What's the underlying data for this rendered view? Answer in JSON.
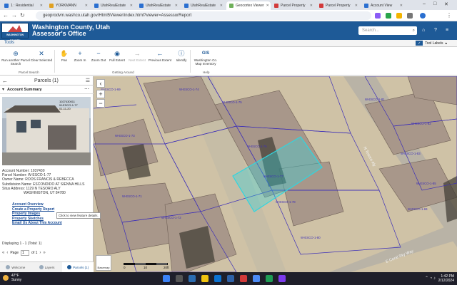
{
  "browser": {
    "tabs": [
      {
        "label": "1 : Residential",
        "color": "#2a6fd0",
        "active": false
      },
      {
        "label": "YORKMANN",
        "color": "#e0a020",
        "active": false
      },
      {
        "label": "UtahRealEstate",
        "color": "#2a6fd0",
        "active": false
      },
      {
        "label": "UtahRealEstate",
        "color": "#2a6fd0",
        "active": false
      },
      {
        "label": "UtahRealEstate",
        "color": "#2a6fd0",
        "active": false
      },
      {
        "label": "Geocortex Viewer",
        "color": "#6fb05a",
        "active": true
      },
      {
        "label": "Parcel Property",
        "color": "#d23a3a",
        "active": false
      },
      {
        "label": "Parcel Property",
        "color": "#d23a3a",
        "active": false
      },
      {
        "label": "Account View",
        "color": "#2a6fd0",
        "active": false
      }
    ],
    "url": "geoprodvm.washco.utah.gov/Html5Viewer/index.html?viewer=AssessorReport"
  },
  "header": {
    "logo_text": "WASHINGTON COUNTY",
    "title_line1": "Washington County, Utah",
    "title_line2": "Assessor's Office",
    "search_placeholder": "Search..."
  },
  "toolbar": {
    "tab_label": "Tools",
    "tool_labels_label": "Tool Labels",
    "tools": [
      {
        "label": "Run another Parcel Search",
        "icon": "binoculars-icon",
        "dim": false
      },
      {
        "label": "Clear Selected",
        "icon": "close-icon",
        "dim": false
      },
      {
        "label": "Pan",
        "icon": "hand-icon",
        "dim": false
      },
      {
        "label": "Zoom In",
        "icon": "plus-icon",
        "dim": false
      },
      {
        "label": "Zoom Out",
        "icon": "minus-icon",
        "dim": false
      },
      {
        "label": "Full Extent",
        "icon": "globe-icon",
        "dim": false
      },
      {
        "label": "Next Extent",
        "icon": "arrow-right-icon",
        "dim": true
      },
      {
        "label": "Previous Extent",
        "icon": "arrow-left-icon",
        "dim": false
      },
      {
        "label": "Identify",
        "icon": "info-icon",
        "dim": false
      },
      {
        "label": "Washington Co. Map Inventory",
        "icon": "gis-icon",
        "dim": false
      }
    ],
    "groups": {
      "search": "Parcel Search",
      "navigation": "Getting Around",
      "help": "Help"
    }
  },
  "panel": {
    "title": "Parcels (1)",
    "section_title": "Account Summary",
    "photo_stamp": [
      "1027430011",
      "W-ESCO-1-77",
      "01-11-20"
    ],
    "info": [
      "Account Number: 1037430",
      "Parcel Number: W-ESCO-1-77",
      "Owner Name: ROOS FRANCIS & REBECCA",
      "Subdivision Name: ESCONDIDO AT SIENNA HILLS",
      "Situs Address: 1129 N TESORO ALY",
      "WASHINGTON, UT 84780"
    ],
    "links": [
      "Account Overview",
      "Create a Property Report",
      "Property Images",
      "Property Sketches",
      "Email Us About This Account"
    ],
    "tooltip": "Click to view feature details.",
    "displaying": "Displaying 1 - 1 (Total: 1)",
    "page_label": "Page",
    "page_value": "1",
    "page_of": "of 1"
  },
  "widgets": [
    {
      "label": "Welcome",
      "active": false
    },
    {
      "label": "Layers",
      "active": false
    },
    {
      "label": "Parcels (1)",
      "active": true
    }
  ],
  "map": {
    "parcel_labels": [
      "W-ESCO-1-77",
      "W-ESCO-1-76",
      "W-ESCO-1-78",
      "W-ESCO-1-75",
      "W-ESCO-1-74",
      "W-ESCO-1-73",
      "W-ESCO-1-80",
      "W-ESCO-1-81",
      "W-ESCO-1-82",
      "W-ESCO-1-69",
      "W-ESCO-1-71",
      "W-ESCO-1-83",
      "W-ESCO-1-72",
      "W-ESCO-1-85",
      "W-ESCO-1-84"
    ],
    "street_labels": [
      "N Tesoro Aly",
      "E Coral Sky Way"
    ],
    "scale_labels": [
      "0",
      "10",
      "20ft"
    ],
    "basemap_label": "Basemap"
  },
  "taskbar": {
    "temperature": "47°F",
    "condition": "Sunny",
    "time": "1:42 PM",
    "date": "2/12/2024"
  },
  "colors": {
    "header_blue": "#1e5a97",
    "selection_cyan": "#2fd6e0",
    "parcel_line": "#3d2fb8"
  }
}
